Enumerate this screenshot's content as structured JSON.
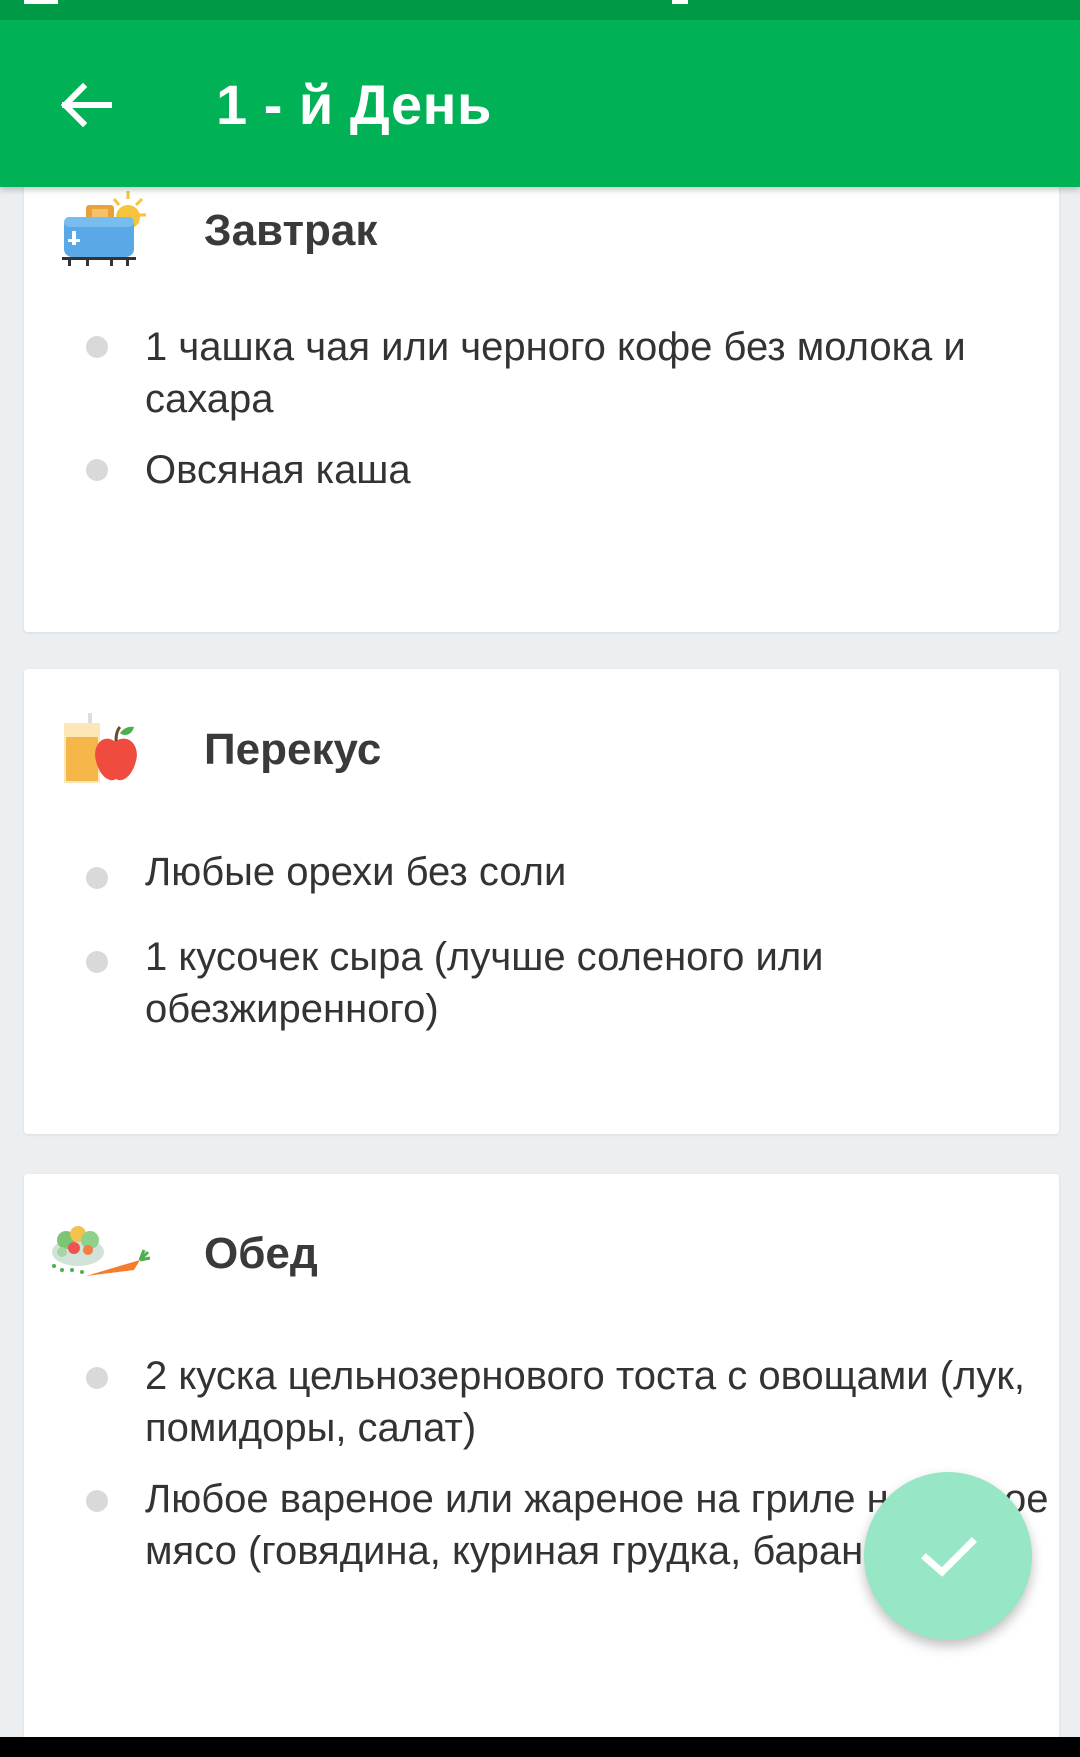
{
  "app_bar": {
    "title": "1 - й День",
    "back_icon": "arrow-back-icon",
    "color": "#00b156"
  },
  "meals": [
    {
      "title": "Завтрак",
      "icon": "toaster-icon",
      "items": [
        "1 чашка чая или черного кофе без молока и сахара",
        "Овсяная каша"
      ]
    },
    {
      "title": "Перекус",
      "icon": "juice-apple-icon",
      "items": [
        "Любые орехи без соли",
        "1 кусочек сыра (лучше соленого или обезжиренного)"
      ]
    },
    {
      "title": "Обед",
      "icon": "salad-carrot-icon",
      "items": [
        "2 куска цельнозернового тоста с овощами (лук, помидоры, салат)",
        "Любое вареное или жареное на гриле нежирное мясо (говядина, куриная грудка, баранина)"
      ]
    }
  ],
  "fab": {
    "icon": "check-icon",
    "color": "#97e6c6"
  }
}
